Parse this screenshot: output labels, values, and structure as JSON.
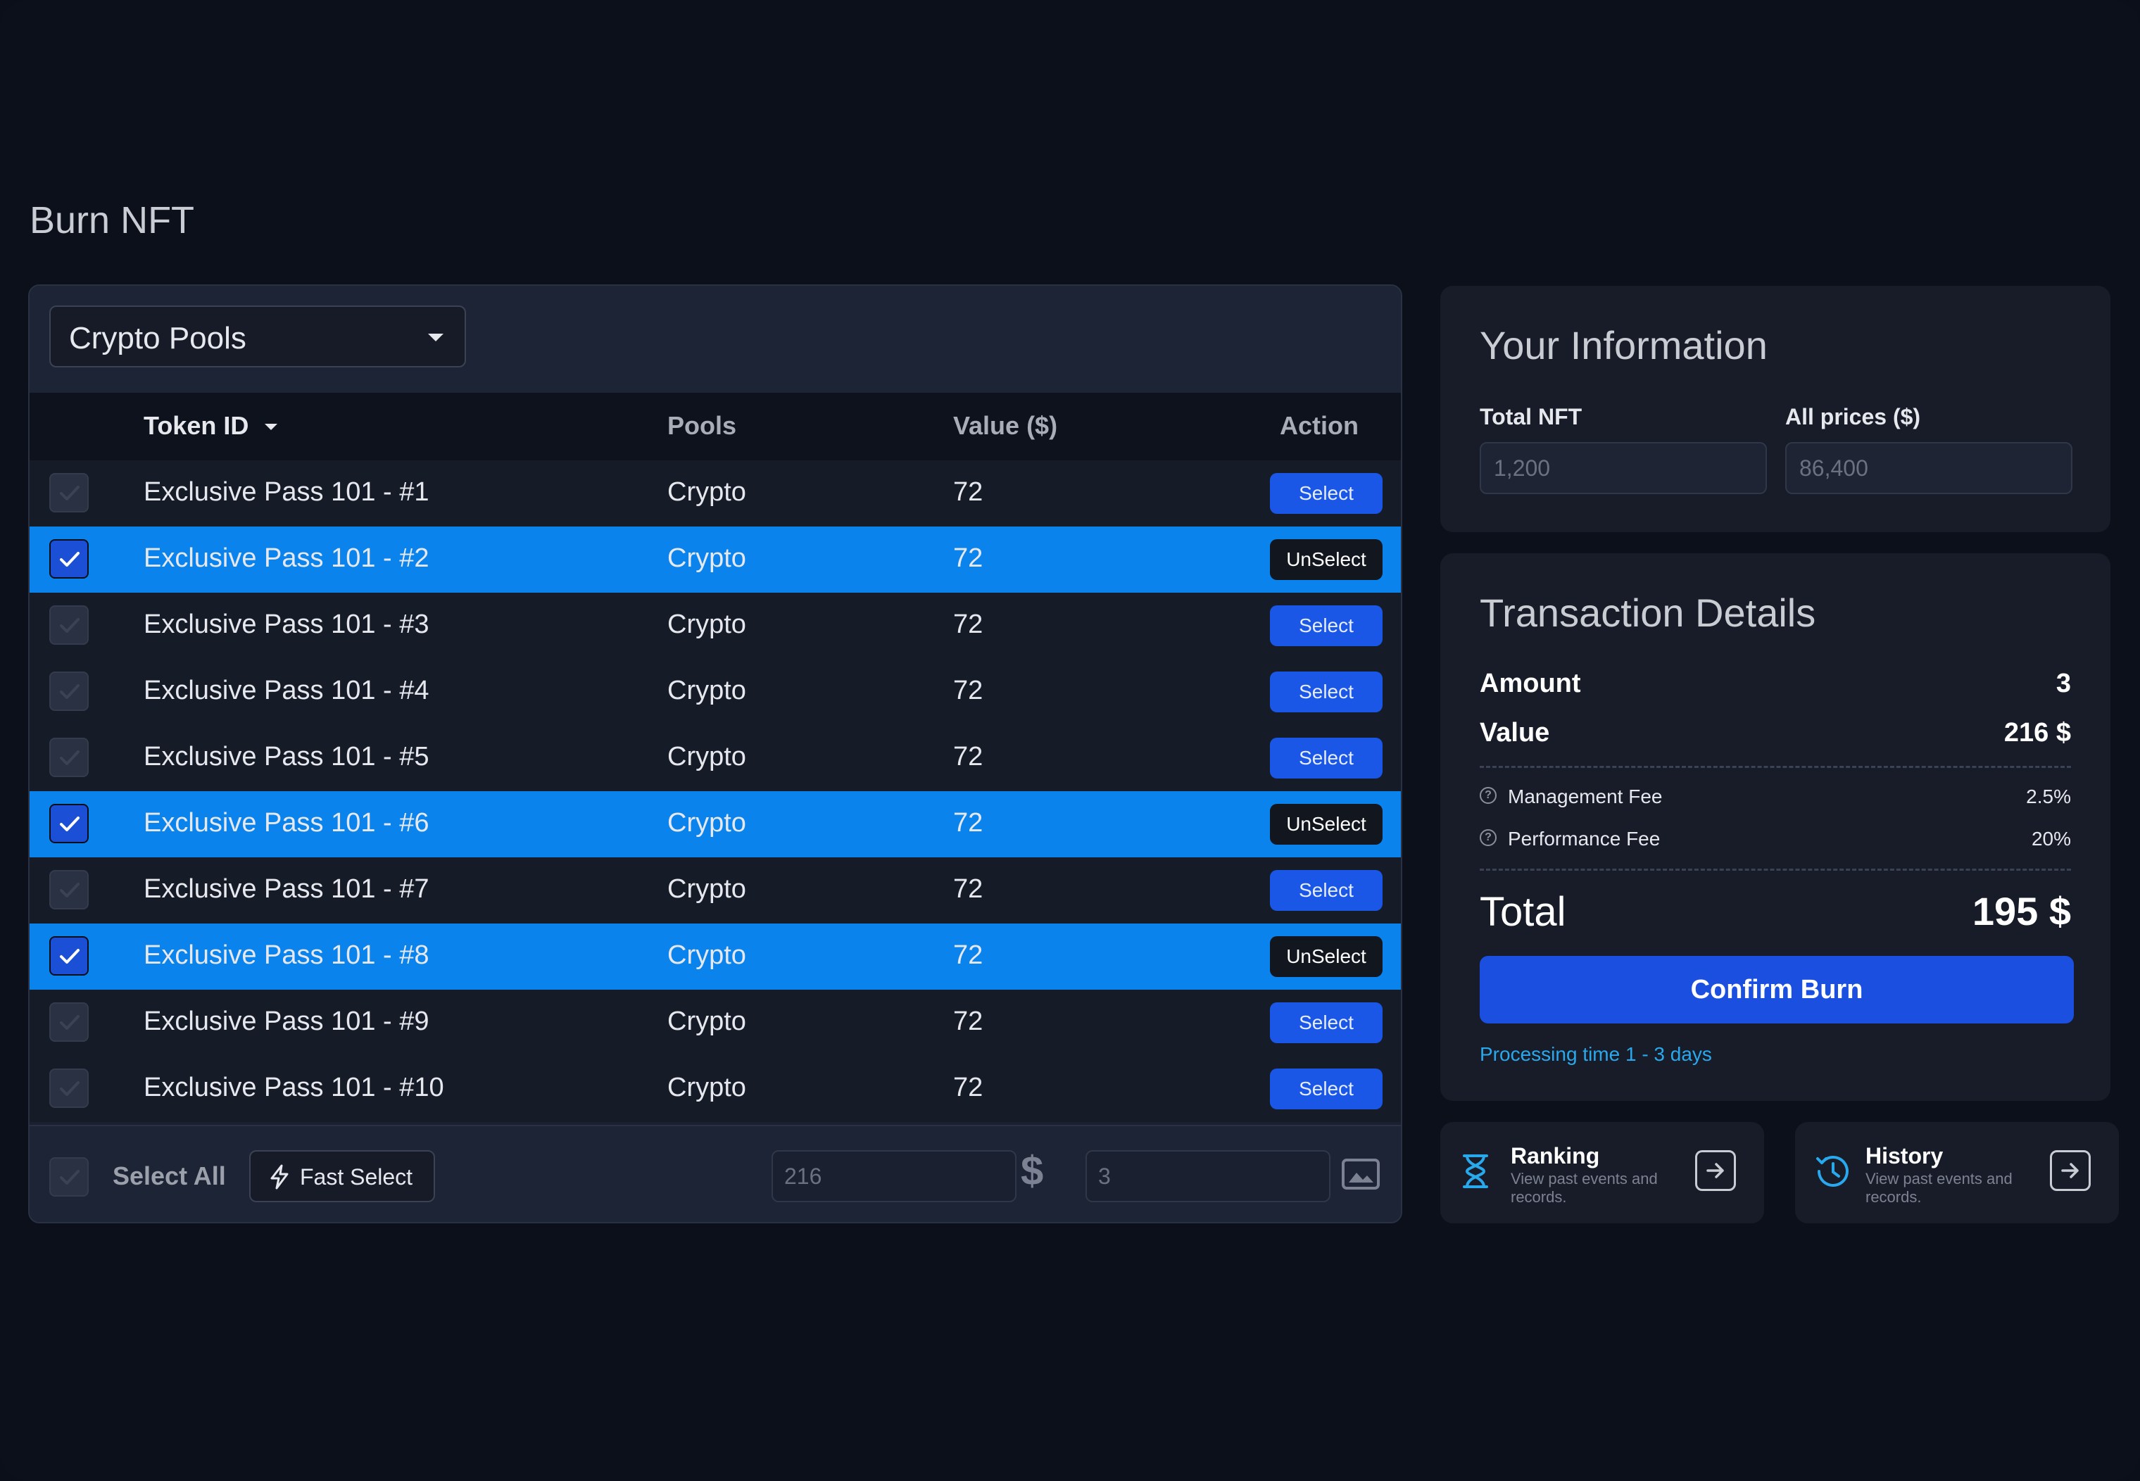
{
  "page_title": "Burn NFT",
  "pool_dropdown": {
    "selected": "Crypto Pools"
  },
  "table": {
    "headers": {
      "token_id": "Token ID",
      "pools": "Pools",
      "value": "Value ($)",
      "action": "Action"
    },
    "rows": [
      {
        "token": "Exclusive Pass 101 - #1",
        "pool": "Crypto",
        "value": "72",
        "selected": false,
        "action": "Select"
      },
      {
        "token": "Exclusive Pass 101 - #2",
        "pool": "Crypto",
        "value": "72",
        "selected": true,
        "action": "UnSelect"
      },
      {
        "token": "Exclusive Pass 101 - #3",
        "pool": "Crypto",
        "value": "72",
        "selected": false,
        "action": "Select"
      },
      {
        "token": "Exclusive Pass 101 - #4",
        "pool": "Crypto",
        "value": "72",
        "selected": false,
        "action": "Select"
      },
      {
        "token": "Exclusive Pass 101 - #5",
        "pool": "Crypto",
        "value": "72",
        "selected": false,
        "action": "Select"
      },
      {
        "token": "Exclusive Pass 101 - #6",
        "pool": "Crypto",
        "value": "72",
        "selected": true,
        "action": "UnSelect"
      },
      {
        "token": "Exclusive Pass 101 - #7",
        "pool": "Crypto",
        "value": "72",
        "selected": false,
        "action": "Select"
      },
      {
        "token": "Exclusive Pass 101 - #8",
        "pool": "Crypto",
        "value": "72",
        "selected": true,
        "action": "UnSelect"
      },
      {
        "token": "Exclusive Pass 101 - #9",
        "pool": "Crypto",
        "value": "72",
        "selected": false,
        "action": "Select"
      },
      {
        "token": "Exclusive Pass 101 - #10",
        "pool": "Crypto",
        "value": "72",
        "selected": false,
        "action": "Select"
      }
    ]
  },
  "footer": {
    "select_all": "Select All",
    "fast_select": "Fast Select",
    "value_input": "216",
    "quantity_input": "3"
  },
  "info": {
    "title": "Your Information",
    "total_nft_label": "Total NFT",
    "total_nft_value": "1,200",
    "all_prices_label": "All prices ($)",
    "all_prices_value": "86,400"
  },
  "transaction": {
    "title": "Transaction Details",
    "amount_label": "Amount",
    "amount_value": "3",
    "value_label": "Value",
    "value_value": "216 $",
    "management_fee_label": "Management Fee",
    "management_fee_value": "2.5%",
    "performance_fee_label": "Performance Fee",
    "performance_fee_value": "20%",
    "total_label": "Total",
    "total_value": "195 $",
    "confirm_label": "Confirm Burn",
    "processing_time": "Processing time 1 - 3 days"
  },
  "nav_cards": {
    "ranking": {
      "title": "Ranking",
      "desc": "View past events and records."
    },
    "history": {
      "title": "History",
      "desc": "View past events and records."
    }
  },
  "colors": {
    "background": "#0c101a",
    "selected_row": "#0a84ec",
    "primary_button": "#1a4fe0",
    "accent_text": "#2aa8ee"
  }
}
